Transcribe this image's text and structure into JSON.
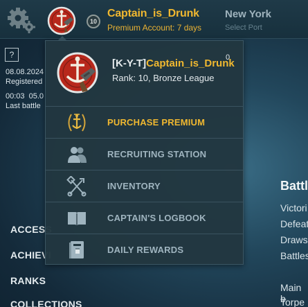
{
  "topbar": {
    "player_name": "Captain_is_Drunk",
    "premium_status": "Premium Account: 7 days",
    "level": "10",
    "port_name": "New York",
    "port_action": "Select Port",
    "icons": [
      "gear-icon",
      "anchor-avatar-icon",
      "level-badge"
    ]
  },
  "left_info": {
    "help": "?",
    "registered_date": "08.08.2024",
    "registered_label": "Registered",
    "last_battle_value": "00:03  05.0",
    "last_battle_label": "Last battle"
  },
  "left_menu": [
    "ACCESS",
    "ACHIEVI",
    "RANKS",
    "COLLECTIONS"
  ],
  "right_stats": {
    "title": "Battle",
    "labels": [
      "Victori",
      "Defeat",
      "Draws",
      "Battles",
      "Main b",
      "Torpe"
    ]
  },
  "dropdown": {
    "clan_tag": "[K-Y-T]",
    "player_name": "Captain_is_Drunk",
    "superscript": "0",
    "rank_text": "Rank: 10, Bronze League",
    "items": [
      {
        "label": "PURCHASE PREMIUM",
        "icon": "anchor-premium-icon"
      },
      {
        "label": "RECRUITING STATION",
        "icon": "recruits-icon"
      },
      {
        "label": "INVENTORY",
        "icon": "crossed-tools-icon"
      },
      {
        "label": "CAPTAIN'S LOGBOOK",
        "icon": "open-book-icon"
      },
      {
        "label": "DAILY REWARDS",
        "icon": "calendar-book-icon"
      }
    ]
  },
  "colors": {
    "accent_gold": "#f0b830",
    "menu_text": "#9fb4bf",
    "panel_bg": "#223740",
    "avatar_red": "#c62a1e"
  }
}
